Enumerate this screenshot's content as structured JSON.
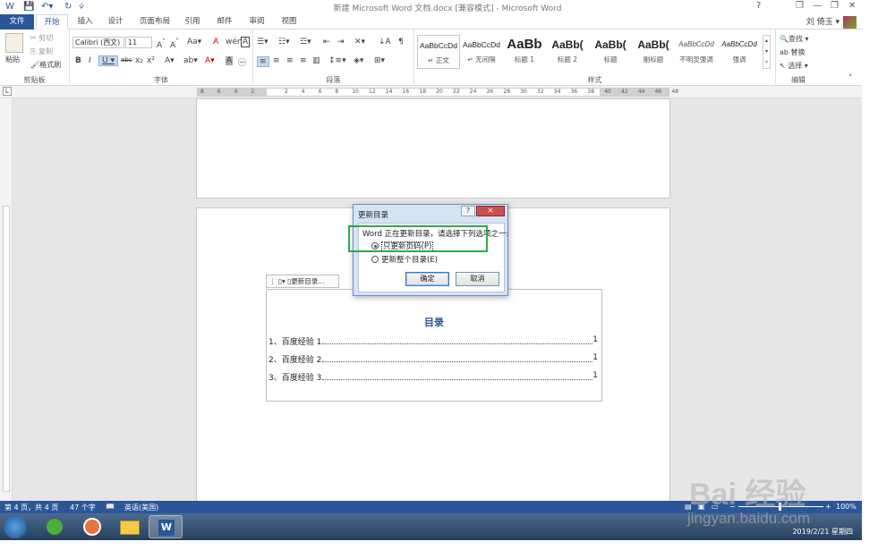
{
  "window": {
    "title": "新建 Microsoft Word 文档.docx [兼容模式] - Microsoft Word",
    "help_glyph": "?",
    "minimize_glyph": "—",
    "restore_glyph": "❐",
    "close_glyph": "✕"
  },
  "qat": {
    "save_icon": "save-icon",
    "undo_icon": "undo-icon",
    "redo_icon": "redo-icon"
  },
  "tabs": [
    {
      "label": "文件"
    },
    {
      "label": "开始"
    },
    {
      "label": "插入"
    },
    {
      "label": "设计"
    },
    {
      "label": "页面布局"
    },
    {
      "label": "引用"
    },
    {
      "label": "邮件"
    },
    {
      "label": "审阅"
    },
    {
      "label": "视图"
    }
  ],
  "user": {
    "name": "刘 倚玉 ▾"
  },
  "ribbon": {
    "clipboard": {
      "label": "剪贴板",
      "paste": "粘贴",
      "cut": "剪切",
      "copy": "复制",
      "format_painter": "格式刷"
    },
    "font": {
      "label": "字体",
      "font_name": "Calibri (西文)",
      "font_size": "11"
    },
    "paragraph": {
      "label": "段落"
    },
    "styles": {
      "label": "样式",
      "items": [
        {
          "sample": "AaBbCcDd",
          "name": "↵ 正文"
        },
        {
          "sample": "AaBbCcDd",
          "name": "↵ 无间隔"
        },
        {
          "sample": "AaBb",
          "name": "标题 1"
        },
        {
          "sample": "AaBb(",
          "name": "标题 2"
        },
        {
          "sample": "AaBb(",
          "name": "标题"
        },
        {
          "sample": "AaBb(",
          "name": "副标题"
        },
        {
          "sample": "AaBbCcDd",
          "name": "不明显强调"
        },
        {
          "sample": "AaBbCcDd",
          "name": "强调"
        }
      ]
    },
    "editing": {
      "label": "编辑",
      "find": "查找 ▾",
      "replace": "替换",
      "select": "选择 ▾"
    }
  },
  "ruler": {
    "ticks": [
      "8",
      "6",
      "4",
      "2",
      "",
      "2",
      "4",
      "6",
      "8",
      "10",
      "12",
      "14",
      "16",
      "18",
      "20",
      "22",
      "24",
      "26",
      "28",
      "30",
      "32",
      "34",
      "36",
      "38",
      "40",
      "42",
      "44",
      "46",
      "48"
    ]
  },
  "document": {
    "toc_toolbar_label": "更新目录...",
    "toc_title": "目录",
    "toc_entries": [
      {
        "text": "1、百度经验 1",
        "page": "1"
      },
      {
        "text": "2、百度经验 2",
        "page": "1"
      },
      {
        "text": "3、百度经验 3",
        "page": "1"
      }
    ]
  },
  "dialog": {
    "title": "更新目录",
    "help": "?",
    "close": "✕",
    "message": "Word 正在更新目录，请选择下列选项之一:",
    "option_pages_only": "只更新页码(P)",
    "option_entire": "更新整个目录(E)",
    "ok": "确定",
    "cancel": "取消"
  },
  "status": {
    "page": "第 4 页，共 4 页",
    "words": "47 个字",
    "language": "英语(美国)",
    "zoom": "100%"
  },
  "taskbar": {
    "clock": "2019/2/21 星期四"
  },
  "watermark": {
    "brand": "Bai 经验",
    "url": "jingyan.baidu.com"
  },
  "colors": {
    "accent": "#2b579a",
    "highlight_box": "#2ea84a",
    "toc_title": "#2f5496"
  }
}
